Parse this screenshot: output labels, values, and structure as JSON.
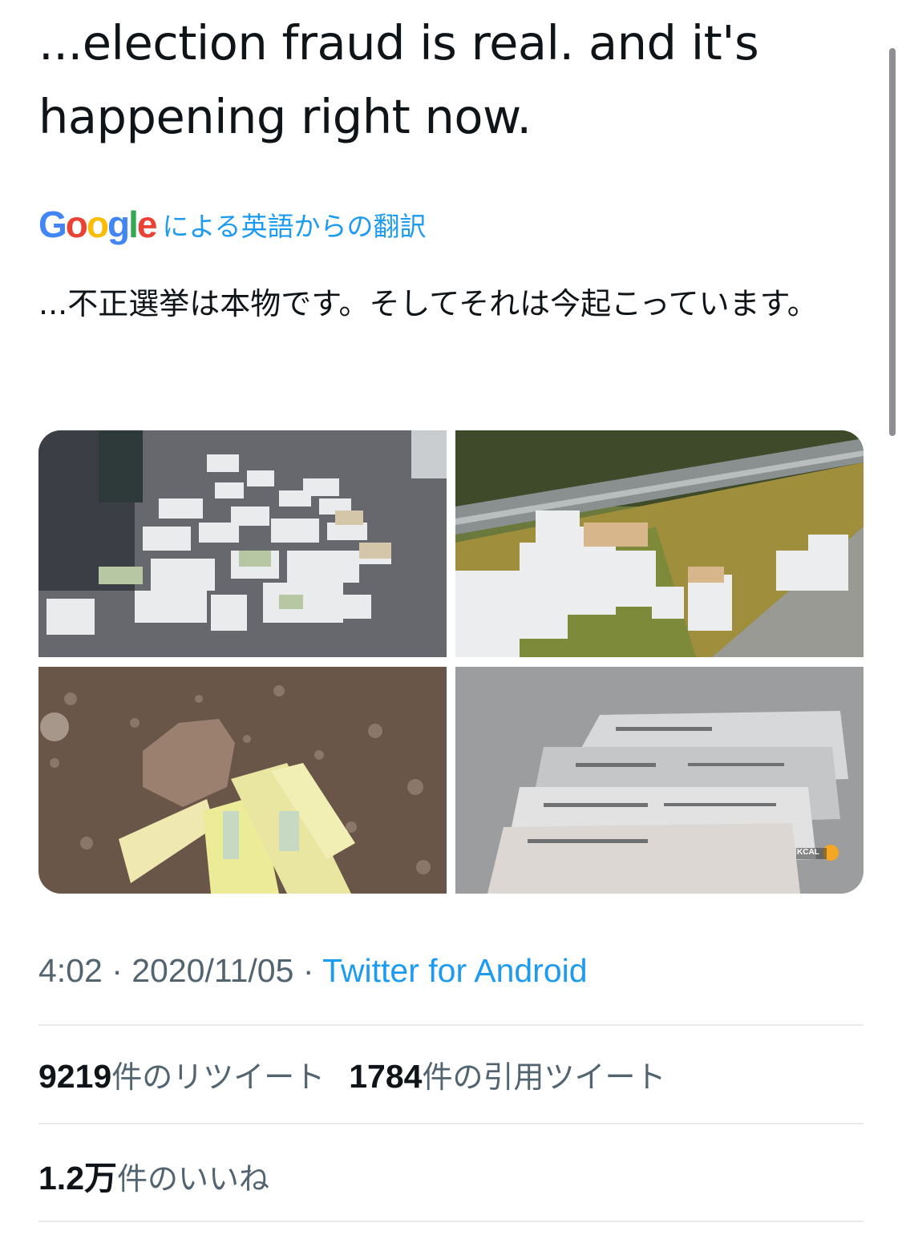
{
  "tweet": {
    "text": "...election fraud is real. and it's happening right now.",
    "translation": {
      "provider_letters": [
        "G",
        "o",
        "o",
        "g",
        "l",
        "e"
      ],
      "label": "による英語からの翻訳",
      "text": "...不正選挙は本物です。そしてそれは今起こっています。"
    },
    "media": [
      {
        "icon": "photo-ballots-on-pavement"
      },
      {
        "icon": "photo-mail-trays-by-guardrail"
      },
      {
        "icon": "photo-ballots-under-rock"
      },
      {
        "icon": "photo-ballot-envelopes-closeup",
        "watermark": "KCAL"
      }
    ],
    "meta": {
      "time": "4:02",
      "separator": " · ",
      "date": "2020/11/05",
      "source": "Twitter for Android"
    },
    "stats": {
      "retweets_count": "9219",
      "retweets_label": "件のリツイート",
      "quotes_count": "1784",
      "quotes_label": "件の引用ツイート",
      "likes_count": "1.2万",
      "likes_label": "件のいいね"
    }
  }
}
